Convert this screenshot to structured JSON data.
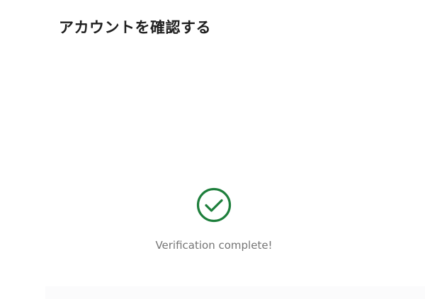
{
  "page": {
    "title": "アカウントを確認する"
  },
  "verification": {
    "status_icon": "check-circle-icon",
    "status_color": "#1e7f3c",
    "message": "Verification complete!"
  },
  "colors": {
    "background": "#ffffff",
    "title": "#1f1f1f",
    "message": "#757575"
  }
}
